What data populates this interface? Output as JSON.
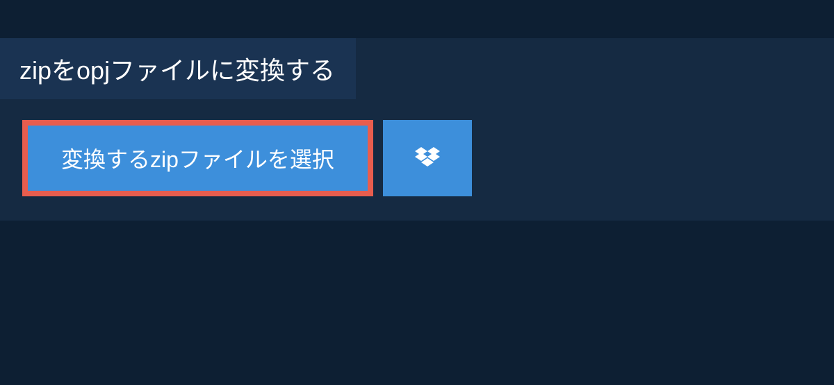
{
  "heading": "zipをopjファイルに変換する",
  "buttons": {
    "select_file_label": "変換するzipファイルを選択"
  }
}
